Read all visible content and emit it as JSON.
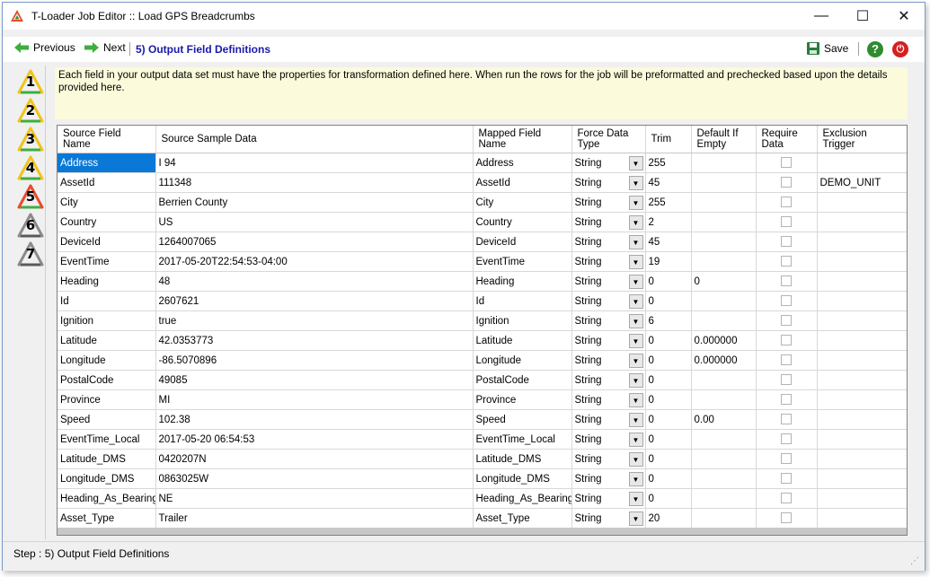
{
  "window": {
    "title": "T-Loader Job Editor :: Load GPS Breadcrumbs",
    "minimize": "—",
    "maximize": "☐",
    "close": "✕"
  },
  "toolbar": {
    "previous_label": "Previous",
    "next_label": "Next",
    "step_label": "5) Output Field Definitions",
    "save_label": "Save",
    "help_label": "?",
    "power_label": "⏻"
  },
  "steps": [
    "1",
    "2",
    "3",
    "4",
    "5",
    "6",
    "7"
  ],
  "info": {
    "text": "Each field in your output data set must have the properties for transformation defined here. When run the rows for the job will be preformatted and prechecked based upon the details provided here."
  },
  "grid": {
    "columns": [
      "Source Field Name",
      "Source Sample Data",
      "Mapped Field Name",
      "Force Data Type",
      "Trim",
      "Default If Empty",
      "Require Data",
      "Exclusion Trigger"
    ],
    "rows": [
      {
        "source": "Address",
        "sample": "I 94",
        "mapped": "Address",
        "type": "String",
        "trim": "255",
        "default": "",
        "trigger": ""
      },
      {
        "source": "AssetId",
        "sample": "111348",
        "mapped": "AssetId",
        "type": "String",
        "trim": "45",
        "default": "",
        "trigger": "DEMO_UNIT"
      },
      {
        "source": "City",
        "sample": "Berrien County",
        "mapped": "City",
        "type": "String",
        "trim": "255",
        "default": "",
        "trigger": ""
      },
      {
        "source": "Country",
        "sample": "US",
        "mapped": "Country",
        "type": "String",
        "trim": "2",
        "default": "",
        "trigger": ""
      },
      {
        "source": "DeviceId",
        "sample": "1264007065",
        "mapped": "DeviceId",
        "type": "String",
        "trim": "45",
        "default": "",
        "trigger": ""
      },
      {
        "source": "EventTime",
        "sample": "2017-05-20T22:54:53-04:00",
        "mapped": "EventTime",
        "type": "String",
        "trim": "19",
        "default": "",
        "trigger": ""
      },
      {
        "source": "Heading",
        "sample": "48",
        "mapped": "Heading",
        "type": "String",
        "trim": "0",
        "default": "0",
        "trigger": ""
      },
      {
        "source": "Id",
        "sample": "2607621",
        "mapped": "Id",
        "type": "String",
        "trim": "0",
        "default": "",
        "trigger": ""
      },
      {
        "source": "Ignition",
        "sample": "true",
        "mapped": "Ignition",
        "type": "String",
        "trim": "6",
        "default": "",
        "trigger": ""
      },
      {
        "source": "Latitude",
        "sample": "42.0353773",
        "mapped": "Latitude",
        "type": "String",
        "trim": "0",
        "default": "0.000000",
        "trigger": ""
      },
      {
        "source": "Longitude",
        "sample": "-86.5070896",
        "mapped": "Longitude",
        "type": "String",
        "trim": "0",
        "default": "0.000000",
        "trigger": ""
      },
      {
        "source": "PostalCode",
        "sample": "49085",
        "mapped": "PostalCode",
        "type": "String",
        "trim": "0",
        "default": "",
        "trigger": ""
      },
      {
        "source": "Province",
        "sample": "MI",
        "mapped": "Province",
        "type": "String",
        "trim": "0",
        "default": "",
        "trigger": ""
      },
      {
        "source": "Speed",
        "sample": "102.38",
        "mapped": "Speed",
        "type": "String",
        "trim": "0",
        "default": "0.00",
        "trigger": ""
      },
      {
        "source": "EventTime_Local",
        "sample": "2017-05-20 06:54:53",
        "mapped": "EventTime_Local",
        "type": "String",
        "trim": "0",
        "default": "",
        "trigger": ""
      },
      {
        "source": "Latitude_DMS",
        "sample": "0420207N",
        "mapped": "Latitude_DMS",
        "type": "String",
        "trim": "0",
        "default": "",
        "trigger": ""
      },
      {
        "source": "Longitude_DMS",
        "sample": "0863025W",
        "mapped": "Longitude_DMS",
        "type": "String",
        "trim": "0",
        "default": "",
        "trigger": ""
      },
      {
        "source": "Heading_As_Bearing",
        "sample": "NE",
        "mapped": "Heading_As_Bearing",
        "type": "String",
        "trim": "0",
        "default": "",
        "trigger": ""
      },
      {
        "source": "Asset_Type",
        "sample": "Trailer",
        "mapped": "Asset_Type",
        "type": "String",
        "trim": "20",
        "default": "",
        "trigger": ""
      }
    ]
  },
  "status": {
    "text": "Step : 5) Output Field Definitions"
  }
}
